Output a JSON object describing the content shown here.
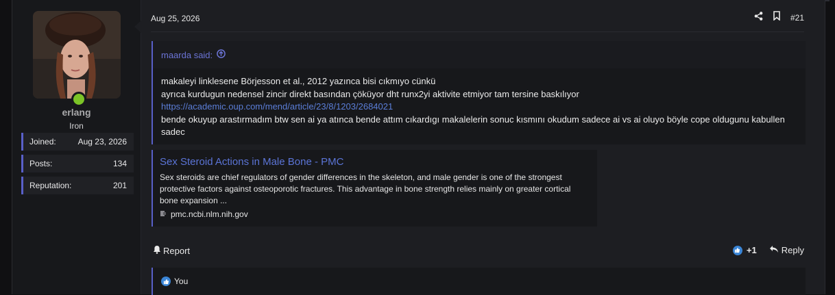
{
  "post": {
    "date": "Aug 25, 2026",
    "number": "#21",
    "share_icon": "share-icon",
    "bookmark_icon": "bookmark-icon"
  },
  "user": {
    "name": "erlang",
    "title": "Iron",
    "online": true,
    "stats": [
      {
        "label": "Joined:",
        "value": "Aug 23, 2026"
      },
      {
        "label": "Posts:",
        "value": "134"
      },
      {
        "label": "Reputation:",
        "value": "201"
      }
    ]
  },
  "quote": {
    "author_said": "maarda said:",
    "lines": [
      "makaleyi linklesene Börjesson et al., 2012 yazınca bisi cıkmıyo cünkü",
      "ayrıca kurdugun nedensel zincir direkt basından çöküyor dht runx2yi aktivite etmiyor tam tersine baskılıyor"
    ],
    "link": "https://academic.oup.com/mend/article/23/8/1203/2684021",
    "after_link": "bende okuyup arastırmadım btw sen ai ya atınca bende attım cıkardıgı makalelerin sonuc kısmını okudum sadece ai vs ai oluyo böyle cope oldugunu kabullen sadec"
  },
  "unfurl": {
    "title": "Sex Steroid Actions in Male Bone - PMC",
    "description": "Sex steroids are chief regulators of gender differences in the skeleton, and male gender is one of the strongest protective factors against osteoporotic fractures. This advantage in bone strength relies mainly on greater cortical bone expansion ...",
    "host": "pmc.ncbi.nlm.nih.gov"
  },
  "actions": {
    "report": "Report",
    "reaction_count": "+1",
    "reply": "Reply"
  },
  "reactions": {
    "text": "You"
  },
  "colors": {
    "accent": "#5960c9",
    "link": "#5b74d6",
    "online": "#7cc427",
    "like": "#3a85d6"
  }
}
